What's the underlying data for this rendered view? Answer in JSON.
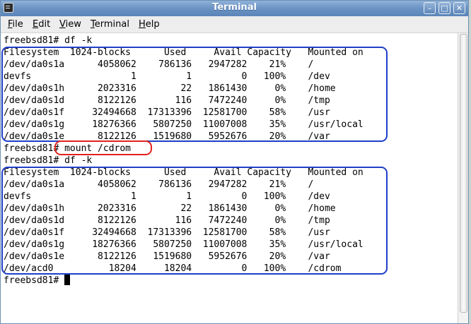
{
  "window": {
    "title": "Terminal"
  },
  "menu": [
    {
      "label": "File",
      "mnemonic": "F",
      "rest": "ile"
    },
    {
      "label": "Edit",
      "mnemonic": "E",
      "rest": "dit"
    },
    {
      "label": "View",
      "mnemonic": "V",
      "rest": "iew"
    },
    {
      "label": "Terminal",
      "mnemonic": "T",
      "rest": "erminal"
    },
    {
      "label": "Help",
      "mnemonic": "H",
      "rest": "elp"
    }
  ],
  "terminal": {
    "lines": [
      "freebsd81# df -k",
      "Filesystem  1024-blocks      Used     Avail Capacity   Mounted on",
      "/dev/da0s1a      4058062    786136   2947282    21%    /",
      "devfs                  1         1         0   100%    /dev",
      "/dev/da0s1h      2023316        22   1861430     0%    /home",
      "/dev/da0s1d      8122126       116   7472240     0%    /tmp",
      "/dev/da0s1f     32494668  17313396  12581700    58%    /usr",
      "/dev/da0s1g     18276366   5807250  11007008    35%    /usr/local",
      "/dev/da0s1e      8122126   1519680   5952676    20%    /var",
      "freebsd81# mount /cdrom",
      "freebsd81# df -k",
      "Filesystem  1024-blocks      Used     Avail Capacity   Mounted on",
      "/dev/da0s1a      4058062    786136   2947282    21%    /",
      "devfs                  1         1         0   100%    /dev",
      "/dev/da0s1h      2023316        22   1861430     0%    /home",
      "/dev/da0s1d      8122126       116   7472240     0%    /tmp",
      "/dev/da0s1f     32494668  17313396  12581700    58%    /usr",
      "/dev/da0s1g     18276366   5807250  11007008    35%    /usr/local",
      "/dev/da0s1e      8122126   1519680   5952676    20%    /var",
      "/dev/acd0          18204     18204         0   100%    /cdrom",
      "freebsd81# "
    ]
  },
  "colors": {
    "highlight_box": "#1f3fc7",
    "command_oval": "#e2221c",
    "titlebar": "#6a92c3"
  },
  "icons": {
    "window_menu": "terminal-window-icon",
    "minimize": "minimize-icon",
    "maximize": "maximize-icon",
    "close": "close-icon"
  }
}
